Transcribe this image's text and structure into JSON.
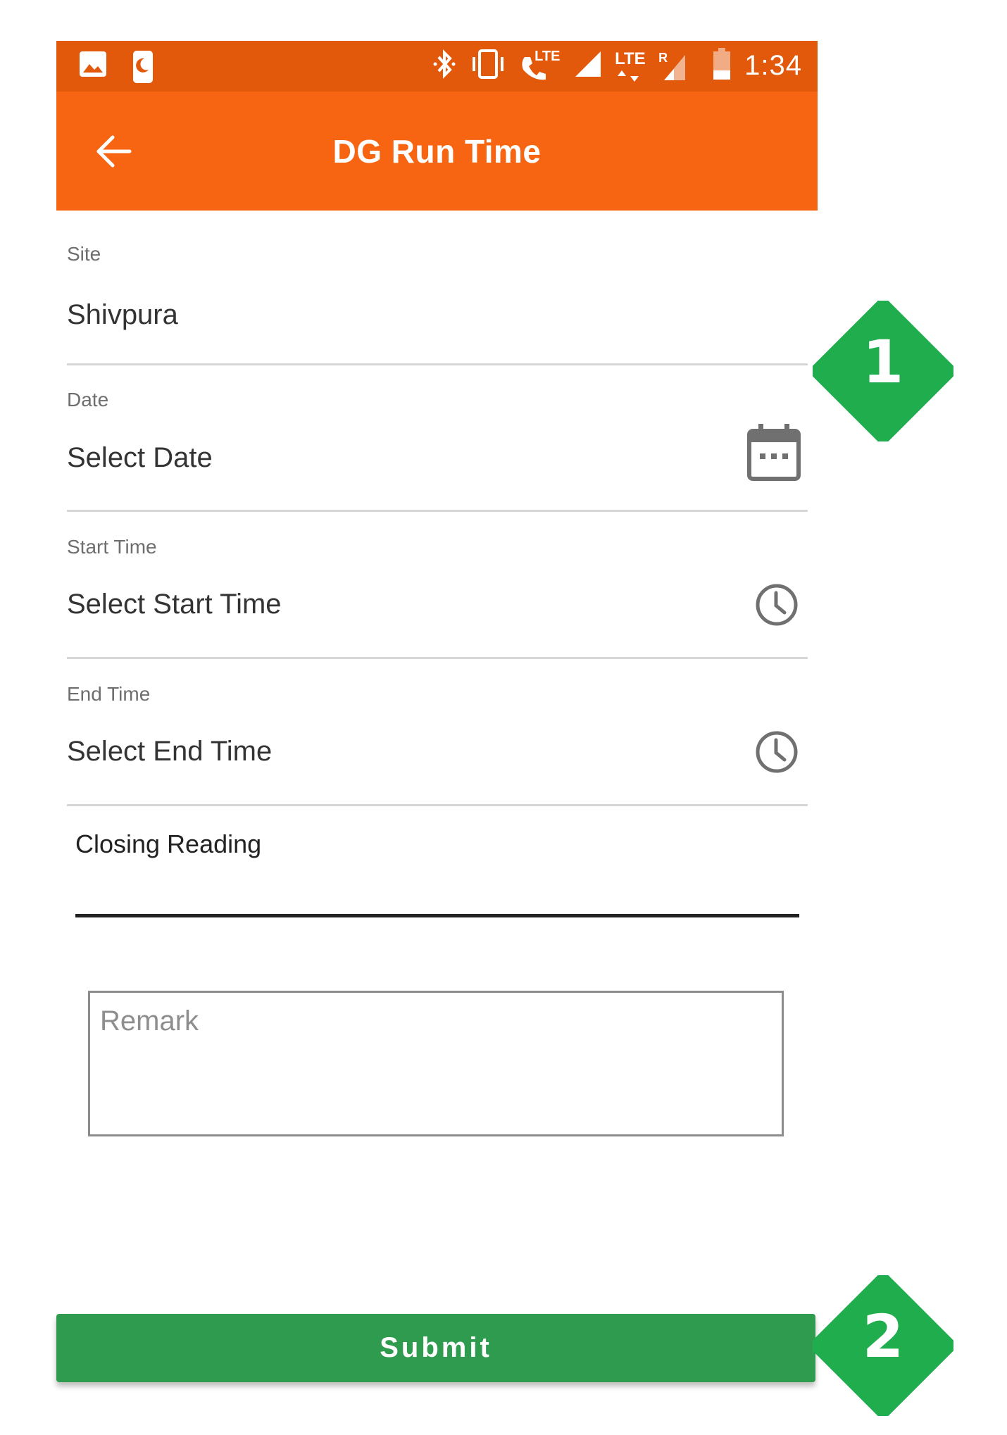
{
  "colors": {
    "status_bar": "#e2590b",
    "app_bar": "#f76513",
    "submit_button": "#2f9b4e",
    "marker": "#1fad4d"
  },
  "status_bar": {
    "icons_left": [
      "image-icon",
      "moon-icon"
    ],
    "icons_right": [
      "bluetooth-icon",
      "vibrate-icon",
      "volte-call-icon",
      "signal-icon",
      "lte-icon",
      "roaming-signal-icon",
      "battery-icon"
    ],
    "call_badge": "LTE",
    "data_badge": "LTE",
    "roaming_badge": "R",
    "time": "1:34"
  },
  "app_bar": {
    "title": "DG Run Time",
    "back_icon": "arrow-left-icon"
  },
  "form": {
    "site": {
      "label": "Site",
      "value": "Shivpura"
    },
    "date": {
      "label": "Date",
      "value": "Select Date",
      "icon": "calendar-icon"
    },
    "start_time": {
      "label": "Start Time",
      "value": "Select Start Time",
      "icon": "clock-icon"
    },
    "end_time": {
      "label": "End Time",
      "value": "Select End Time",
      "icon": "clock-icon"
    },
    "closing_reading": {
      "label": "Closing Reading",
      "value": ""
    },
    "remark": {
      "placeholder": "Remark",
      "value": ""
    }
  },
  "submit": {
    "label": "Submit"
  },
  "markers": [
    {
      "label": "1"
    },
    {
      "label": "2"
    }
  ]
}
